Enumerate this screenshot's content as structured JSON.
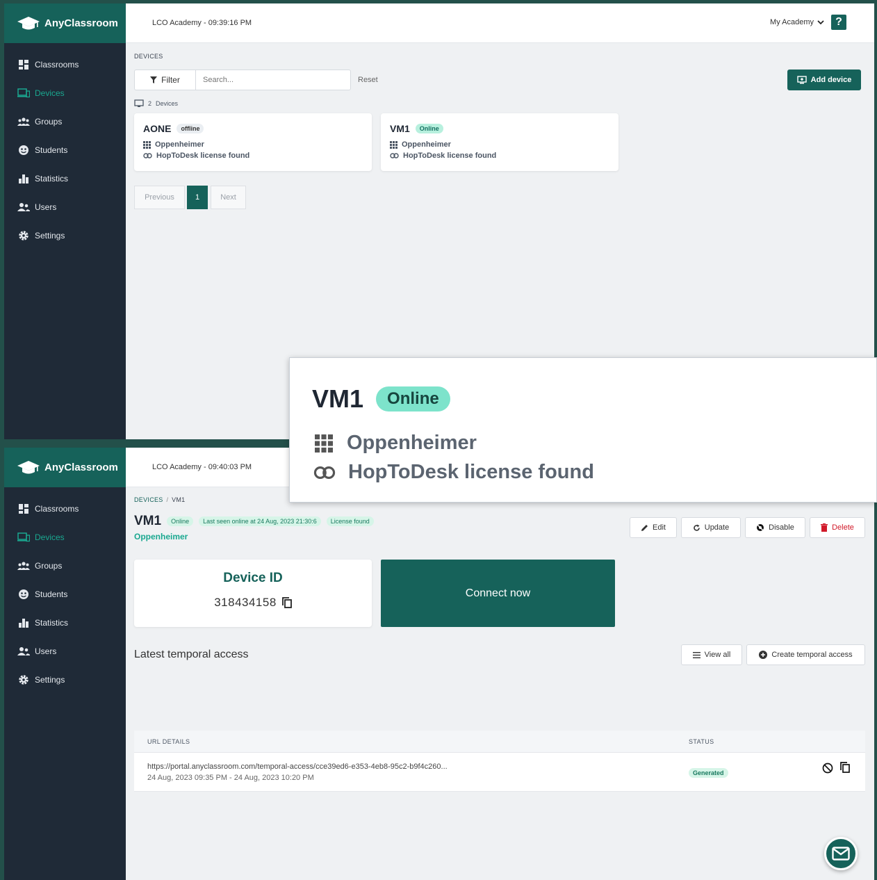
{
  "brand": {
    "name": "AnyClassroom"
  },
  "nav": {
    "items": [
      {
        "label": "Classrooms",
        "icon": "dashboard-icon"
      },
      {
        "label": "Devices",
        "icon": "devices-icon",
        "active": true
      },
      {
        "label": "Groups",
        "icon": "groups-icon"
      },
      {
        "label": "Students",
        "icon": "students-icon"
      },
      {
        "label": "Statistics",
        "icon": "bar-chart-icon"
      },
      {
        "label": "Users",
        "icon": "users-icon"
      },
      {
        "label": "Settings",
        "icon": "gear-icon"
      }
    ]
  },
  "screen1": {
    "topbar": {
      "academy_time": "LCO Academy - 09:39:16 PM",
      "my_academy": "My Academy",
      "help": "?"
    },
    "breadcrumb": "DEVICES",
    "filter_label": "Filter",
    "search_placeholder": "Search...",
    "reset_label": "Reset",
    "add_device_label": "Add device",
    "count_num": "2",
    "count_label": "Devices",
    "devices": [
      {
        "name": "AONE",
        "status": "offline",
        "group": "Oppenheimer",
        "license": "HopToDesk license found"
      },
      {
        "name": "VM1",
        "status": "Online",
        "group": "Oppenheimer",
        "license": "HopToDesk license found"
      }
    ],
    "pagination": {
      "previous": "Previous",
      "page": "1",
      "next": "Next"
    }
  },
  "zoom": {
    "name": "VM1",
    "status": "Online",
    "group": "Oppenheimer",
    "license": "HopToDesk license found"
  },
  "screen2": {
    "topbar": {
      "academy_time": "LCO Academy - 09:40:03 PM"
    },
    "breadcrumb_root": "DEVICES",
    "breadcrumb_sep": "/",
    "breadcrumb_current": "VM1",
    "device_name": "VM1",
    "status_badge": "Online",
    "last_seen": "Last seen online at 24 Aug, 2023 21:30:6",
    "license_badge": "License found",
    "group": "Oppenheimer",
    "actions": {
      "edit": "Edit",
      "update": "Update",
      "disable": "Disable",
      "delete": "Delete"
    },
    "device_id_label": "Device ID",
    "device_id": "318434158",
    "connect_label": "Connect now",
    "temporal_title": "Latest temporal access",
    "view_all": "View all",
    "create_temporal": "Create temporal access",
    "table": {
      "col_url": "URL DETAILS",
      "col_status": "STATUS",
      "rows": [
        {
          "url": "https://portal.anyclassroom.com/temporal-access/cce39ed6-e353-4eb8-95c2-b9f4c260...",
          "range": "24 Aug, 2023 09:35 PM - 24 Aug, 2023 10:20 PM",
          "status": "Generated"
        }
      ]
    }
  },
  "colors": {
    "brand": "#16625a",
    "sidebar": "#1f2a37",
    "accent": "#1aa890",
    "danger": "#d11a2a"
  }
}
